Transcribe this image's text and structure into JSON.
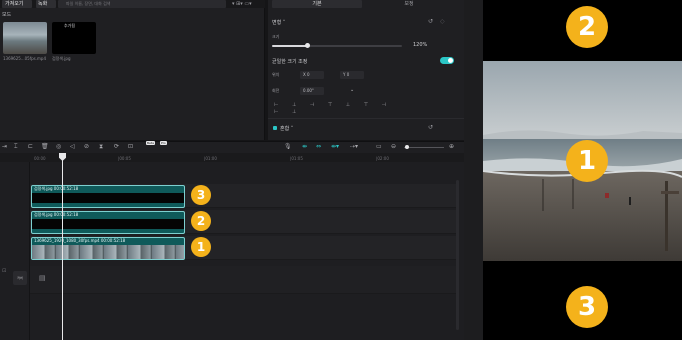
{
  "media": {
    "tab_import": "가져오기",
    "tab_record": "녹화",
    "search_placeholder": "파일 이름, 장면, 대화 검색",
    "section_label": "모드",
    "video_duration": "",
    "video_name": "1369625...05fps.mp4",
    "black_duration": "추가됨",
    "black_name": "검정색.jpg",
    "tools": "▾ ⊞▾ ▭▾"
  },
  "properties": {
    "tab_basic": "기본",
    "tab_adjust": "보정",
    "transform_title": "변형 ˅",
    "scale_label": "크기",
    "scale_value": "120%",
    "scale_fraction": 0.28,
    "uniform_scale_label": "균일한 크기 조정",
    "uniform_scale_on": true,
    "position_label": "위치",
    "position_x": "X    0",
    "position_y": "Y    0",
    "rotation_label": "회전",
    "rotation_value": "0.00°",
    "blend_label": "혼합 ˅",
    "blend_checked": true,
    "reset_icon": "↺",
    "diamond_icon": "◇",
    "align_icons": "⊢ ⊥ ⊣ ⊤ ⊥ ⊤ ⊣ ⊢ ⊥"
  },
  "preview": {
    "background": "#000000",
    "badges": [
      "2",
      "1",
      "3"
    ]
  },
  "timeline": {
    "ruler_ticks": [
      "00:00",
      "|00:05",
      "|01:00",
      "|01:05",
      "|02:00"
    ],
    "tag1": "Beta",
    "tag2": "Pro",
    "tracks": [
      {
        "badge": "3",
        "label": "검정색.jpg   00:00:52:18"
      },
      {
        "badge": "2",
        "label": "검정색.jpg   00:00:52:18"
      },
      {
        "badge": "1",
        "label": "1369625_1920_1080_30fps.mp4   00:00:52:18"
      }
    ],
    "cover_label": "커버",
    "clip_color": "#0f5a5a",
    "badge_color": "#f4b21b"
  }
}
